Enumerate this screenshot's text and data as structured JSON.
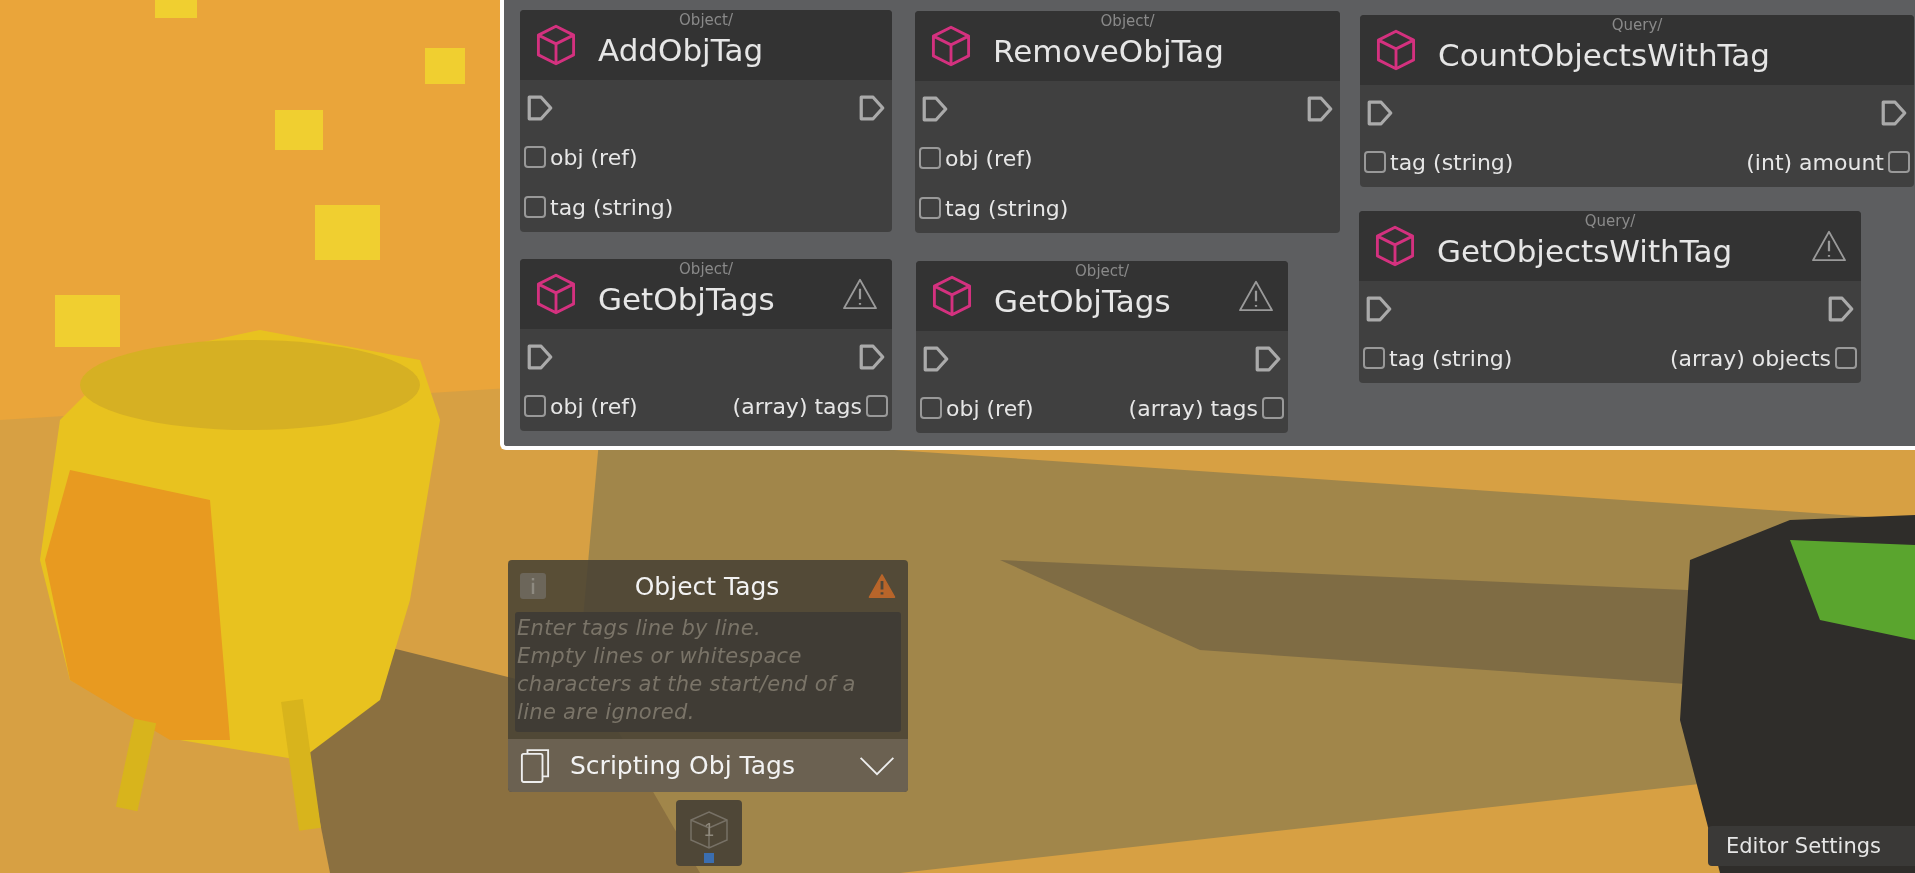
{
  "node_graph": {
    "nodes": [
      {
        "category": "Object/",
        "title": "AddObjTag",
        "warning": false,
        "rows": [
          {
            "input": "obj (ref)"
          },
          {
            "input": "tag (string)"
          }
        ]
      },
      {
        "category": "Object/",
        "title": "RemoveObjTag",
        "warning": false,
        "rows": [
          {
            "input": "obj (ref)"
          },
          {
            "input": "tag (string)"
          }
        ]
      },
      {
        "category": "Query/",
        "title": "CountObjectsWithTag",
        "warning": false,
        "rows": [
          {
            "input": "tag (string)",
            "output": "(int) amount"
          }
        ]
      },
      {
        "category": "Object/",
        "title": "GetObjTags",
        "warning": true,
        "rows": [
          {
            "input": "obj (ref)",
            "output": "(array) tags"
          }
        ]
      },
      {
        "category": "Object/",
        "title": "GetObjTags",
        "warning": true,
        "rows": [
          {
            "input": "obj (ref)",
            "output": "(array) tags"
          }
        ]
      },
      {
        "category": "Query/",
        "title": "GetObjectsWithTag",
        "warning": true,
        "rows": [
          {
            "input": "tag (string)",
            "output": "(array) objects"
          }
        ]
      }
    ]
  },
  "object_tags_panel": {
    "title": "Object Tags",
    "warning": true,
    "placeholder": "Enter tags line by line.\nEmpty lines or whitespace characters at the start/end of a line are ignored.",
    "dropdown": "Scripting Obj Tags"
  },
  "object_button": {
    "count": "1"
  },
  "editor_settings_button": "Editor Settings"
}
